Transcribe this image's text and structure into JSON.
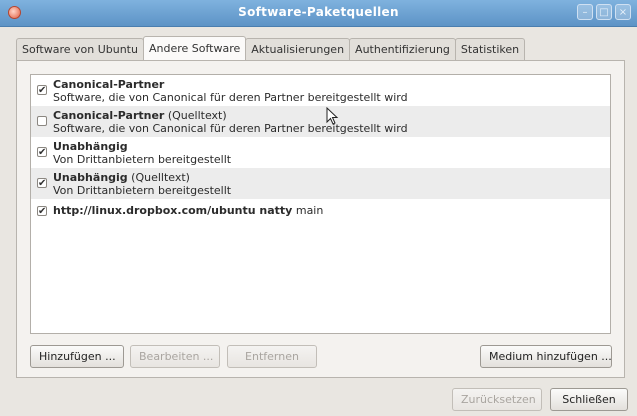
{
  "window": {
    "title": "Software-Paketquellen"
  },
  "tabs": [
    {
      "label": "Software von Ubuntu",
      "active": false
    },
    {
      "label": "Andere Software",
      "active": true
    },
    {
      "label": "Aktualisierungen",
      "active": false
    },
    {
      "label": "Authentifizierung",
      "active": false
    },
    {
      "label": "Statistiken",
      "active": false
    }
  ],
  "sources": [
    {
      "title": "Canonical-Partner",
      "suffix": "",
      "subtitle": "Software, die von Canonical für deren Partner bereitgestellt wird",
      "checked": true
    },
    {
      "title": "Canonical-Partner",
      "suffix": " (Quelltext)",
      "subtitle": "Software, die von Canonical für deren Partner bereitgestellt wird",
      "checked": false
    },
    {
      "title": "Unabhängig",
      "suffix": "",
      "subtitle": "Von Drittanbietern bereitgestellt",
      "checked": true
    },
    {
      "title": "Unabhängig",
      "suffix": " (Quelltext)",
      "subtitle": "Von Drittanbietern bereitgestellt",
      "checked": true
    },
    {
      "title": "http://linux.dropbox.com/ubuntu natty",
      "suffix": " main",
      "subtitle": "",
      "checked": true
    }
  ],
  "buttons": {
    "add": "Hinzufügen ...",
    "edit": "Bearbeiten ...",
    "remove": "Entfernen",
    "add_medium": "Medium hinzufügen ...",
    "revert": "Zurücksetzen",
    "close": "Schließen"
  },
  "icons": {
    "window": "app-icon",
    "checkmark": "✔",
    "cursor": "mouse-pointer-icon"
  }
}
